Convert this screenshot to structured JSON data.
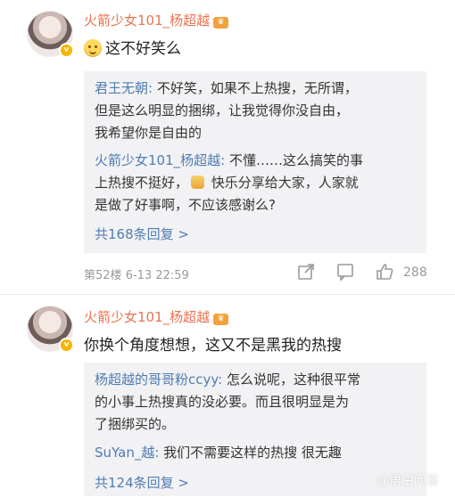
{
  "comments": [
    {
      "author": "火箭少女101_杨超越",
      "level_badge": "♛",
      "text": "这不好笑么",
      "replies": [
        {
          "nick": "君王无朝:",
          "lines": [
            " 不好笑，如果不上热搜，无所谓，",
            "但是这么明显的捆绑，让我觉得你没自由，",
            "我希望你是自由的"
          ]
        },
        {
          "nick": "火箭少女101_杨超越:",
          "lines": [
            " 不懂……这么搞笑的事",
            "上热搜不挺好，",
            " 快乐分享给大家，人家就",
            "是做了好事啊，不应该感谢么?"
          ]
        }
      ],
      "more_replies": "共168条回复 >",
      "floor": "第52楼",
      "date": "6-13 22:59",
      "likes": "288"
    },
    {
      "author": "火箭少女101_杨超越",
      "level_badge": "♛",
      "text": "你换个角度想想，这又不是黑我的热搜",
      "replies": [
        {
          "nick": "杨超越的哥哥粉ccyy:",
          "lines": [
            " 怎么说呢，这种很平常",
            "的小事上热搜真的没必要。而且很明显是为",
            "了捆绑买的。"
          ]
        },
        {
          "nick": "SuYan_越:",
          "lines": [
            " 我们不需要这样的热搜 很无趣"
          ]
        }
      ],
      "more_replies": "共124条回复 >"
    }
  ],
  "verified_badge": "v",
  "watermark": "@悟空问答"
}
